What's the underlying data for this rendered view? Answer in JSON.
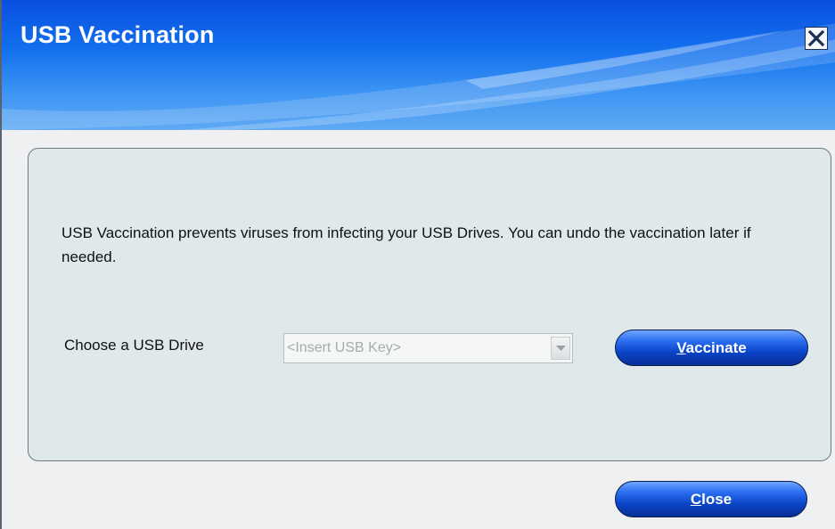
{
  "window": {
    "title": "USB Vaccination"
  },
  "titlebar": {
    "close_icon": "close-x-icon"
  },
  "panel": {
    "description": "USB Vaccination prevents viruses from infecting your USB Drives. You can undo the vaccination later if needed.",
    "drive_label": "Choose a USB Drive",
    "drive_select": {
      "value": "<Insert USB Key>",
      "arrow_icon": "chevron-down-icon"
    },
    "vaccinate_button": {
      "accelerator": "V",
      "rest": "accinate"
    }
  },
  "footer": {
    "close_button": {
      "accelerator": "C",
      "rest": "lose"
    }
  },
  "colors": {
    "title_bar": "#1270ee",
    "panel_bg": "#dfe8ea",
    "button": "#0b45c9"
  }
}
